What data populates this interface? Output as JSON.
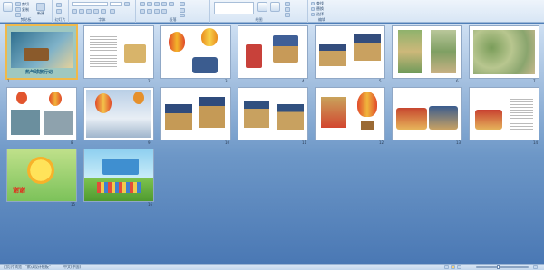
{
  "ribbon": {
    "groups": [
      {
        "label": "剪贴板"
      },
      {
        "label": "幻灯片"
      },
      {
        "label": "字体"
      },
      {
        "label": "段落"
      },
      {
        "label": "绘图"
      },
      {
        "label": "编辑"
      }
    ],
    "clipboard": {
      "cut": "剪切",
      "copy": "复制",
      "paste_fmt": "格式刷",
      "new_slide": "新建"
    },
    "editing": {
      "find": "查找",
      "replace": "替换",
      "select": "选择"
    }
  },
  "slides": [
    {
      "num": "1"
    },
    {
      "num": "2"
    },
    {
      "num": "3"
    },
    {
      "num": "4"
    },
    {
      "num": "5"
    },
    {
      "num": "6"
    },
    {
      "num": "7"
    },
    {
      "num": "8"
    },
    {
      "num": "9"
    },
    {
      "num": "10"
    },
    {
      "num": "11"
    },
    {
      "num": "12"
    },
    {
      "num": "13"
    },
    {
      "num": "14"
    },
    {
      "num": "15"
    },
    {
      "num": "16"
    }
  ],
  "slide1": {
    "title": "热气球旅行记"
  },
  "slide15": {
    "title": "谢谢"
  },
  "status": {
    "slide_sorter": "幻灯片浏览",
    "theme": "\"默认设计模板\"",
    "language": "中文(中国)"
  },
  "colors": {
    "accent": "#f0b94a",
    "background": "#4f7fb8"
  }
}
